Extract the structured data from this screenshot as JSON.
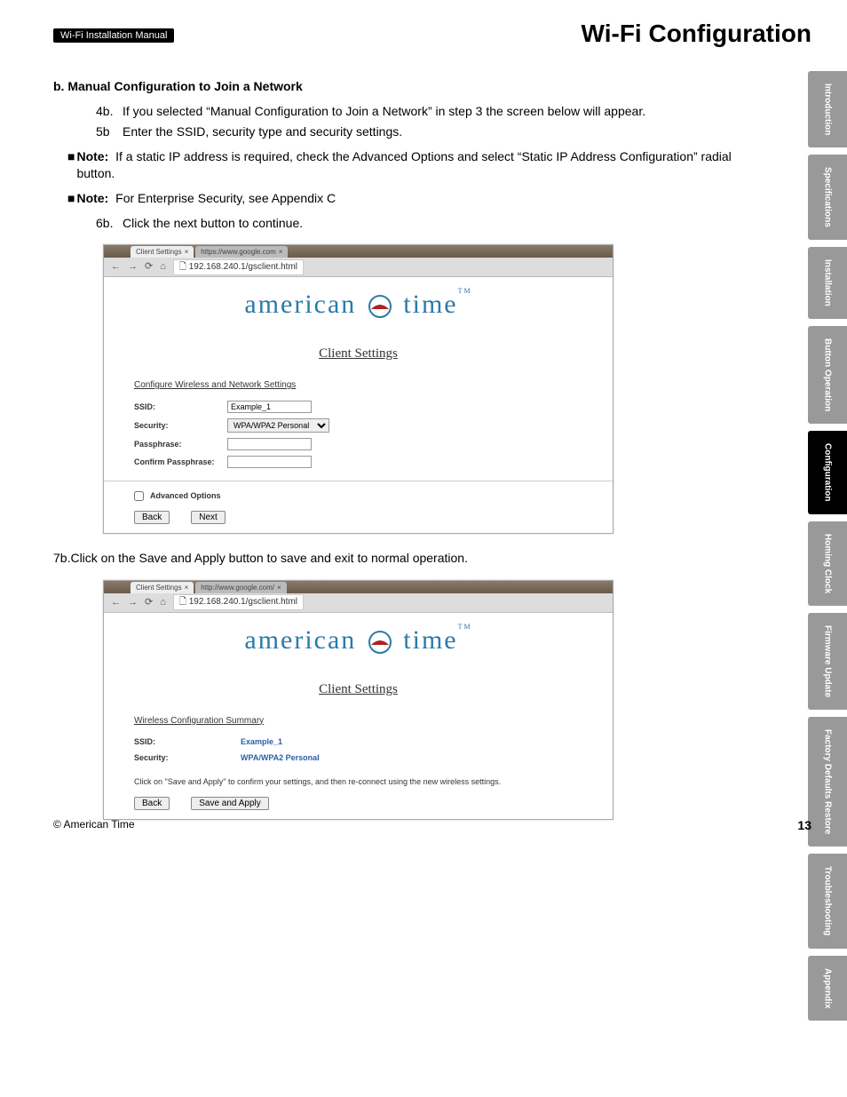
{
  "header": {
    "badge": "Wi-Fi Installation Manual",
    "title": "Wi-Fi Configuration"
  },
  "sidebar": {
    "tabs": [
      {
        "label": "Introduction",
        "active": false
      },
      {
        "label": "Specifications",
        "active": false
      },
      {
        "label": "Installation",
        "active": false
      },
      {
        "label": "Button Operation",
        "active": false
      },
      {
        "label": "Configuration",
        "active": true
      },
      {
        "label": "Homing Clock",
        "active": false
      },
      {
        "label": "Firmware Update",
        "active": false
      },
      {
        "label": "Factory Defaults Restore",
        "active": false
      },
      {
        "label": "Troubleshooting",
        "active": false
      },
      {
        "label": "Appendix",
        "active": false
      }
    ]
  },
  "section": {
    "heading": "b.  Manual Configuration to Join a Network",
    "steps_a": [
      {
        "num": "4b.",
        "txt": "If you selected “Manual Configuration to Join a Network” in step 3 the screen below will appear."
      },
      {
        "num": "5b",
        "txt": "Enter the SSID, security type and security settings."
      }
    ],
    "note1_label": "Note:",
    "note1": " If a static IP address is required, check the Advanced Options and select “Static IP Address Configuration” radial button.",
    "note2_label": "Note:",
    "note2": " For Enterprise Security, see Appendix C",
    "step6": {
      "num": "6b.",
      "txt": "Click the next button to continue."
    },
    "step7": "7b.Click on the Save and Apply button to save and exit to normal operation."
  },
  "shot1": {
    "tab1": "Client Settings",
    "tab2": "https://www.google.com",
    "url": "192.168.240.1/gsclient.html",
    "logo_a": "american",
    "logo_b": "time",
    "logo_tm": "TM",
    "cs": "Client Settings",
    "form_head": "Configure Wireless and Network Settings",
    "ssid_l": "SSID:",
    "ssid_v": "Example_1",
    "sec_l": "Security:",
    "sec_v": "WPA/WPA2 Personal",
    "pass_l": "Passphrase:",
    "cpass_l": "Confirm Passphrase:",
    "adv": "Advanced Options",
    "back": "Back",
    "next": "Next"
  },
  "shot2": {
    "tab1": "Client Settings",
    "tab2": "http://www.google.com/",
    "url": "192.168.240.1/gsclient.html",
    "logo_a": "american",
    "logo_b": "time",
    "logo_tm": "TM",
    "cs": "Client Settings",
    "form_head": "Wireless Configuration Summary",
    "ssid_l": "SSID:",
    "ssid_v": "Example_1",
    "sec_l": "Security:",
    "sec_v": "WPA/WPA2 Personal",
    "instr": "Click on \"Save and Apply\" to confirm your settings, and then re-connect using the new wireless settings.",
    "back": "Back",
    "save": "Save and Apply"
  },
  "footer": {
    "copyright": "© American Time",
    "page": "13"
  }
}
